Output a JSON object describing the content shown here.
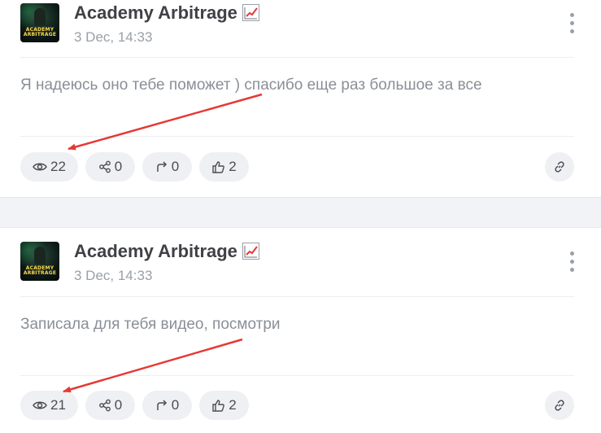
{
  "accent_color": "#e53935",
  "posts": [
    {
      "author": "Academy Arbitrage",
      "author_emoji": "chart-increasing-icon",
      "avatar_text": "ACADEMY ARBITRAGE",
      "date": "3 Dec, 14:33",
      "text": "Я надеюсь оно тебе поможет ) спасибо еще раз большое за все",
      "views": "22",
      "shares": "0",
      "forwards": "0",
      "likes": "2"
    },
    {
      "author": "Academy Arbitrage",
      "author_emoji": "chart-increasing-icon",
      "avatar_text": "ACADEMY ARBITRAGE",
      "date": "3 Dec, 14:33",
      "text": "Записала для тебя видео, посмотри",
      "views": "21",
      "shares": "0",
      "forwards": "0",
      "likes": "2"
    }
  ]
}
